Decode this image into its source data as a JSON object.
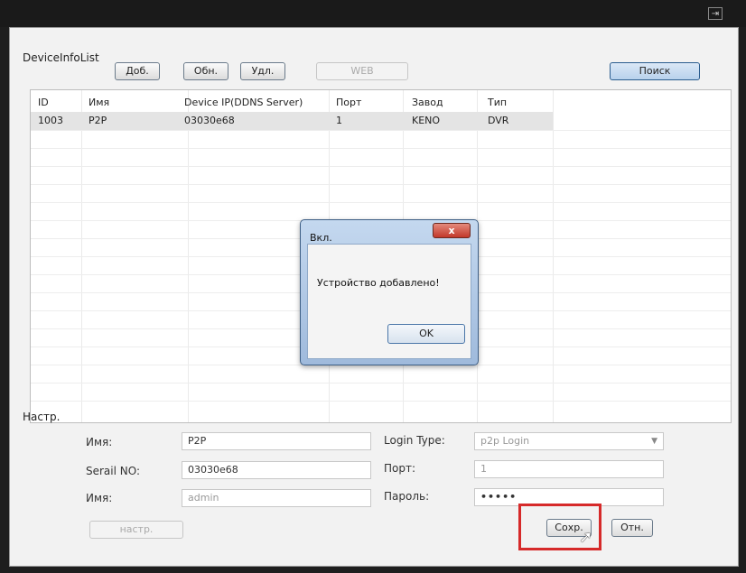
{
  "toolbar": {
    "section_title": "DeviceInfoList",
    "add_label": "Доб.",
    "refresh_label": "Обн.",
    "delete_label": "Удл.",
    "web_label": "WEB",
    "search_label": "Поиск"
  },
  "table": {
    "headers": [
      "ID",
      "Имя",
      "Device IP(DDNS Server)",
      "Порт",
      "Завод",
      "Тип"
    ],
    "rows": [
      [
        "1003",
        "P2P",
        "03030e68",
        "1",
        "KENO",
        "DVR"
      ]
    ]
  },
  "settings": {
    "section_title": "Настр.",
    "name_label": "Имя:",
    "name_value": "P2P",
    "serial_label": "Serail NO:",
    "serial_value": "03030e68",
    "user_label": "Имя:",
    "user_value": "admin",
    "login_type_label": "Login Type:",
    "login_type_value": "p2p Login",
    "port_label": "Порт:",
    "port_value": "1",
    "password_label": "Пароль:",
    "password_value": "•••••",
    "settings_button": "настр.",
    "save_button": "Сохр.",
    "cancel_button": "Отн."
  },
  "dialog": {
    "title": "Вкл.",
    "close_label": "x",
    "message": "Устройство добавлено!",
    "ok_label": "OK"
  },
  "window": {
    "exit_icon": "exit-icon"
  }
}
